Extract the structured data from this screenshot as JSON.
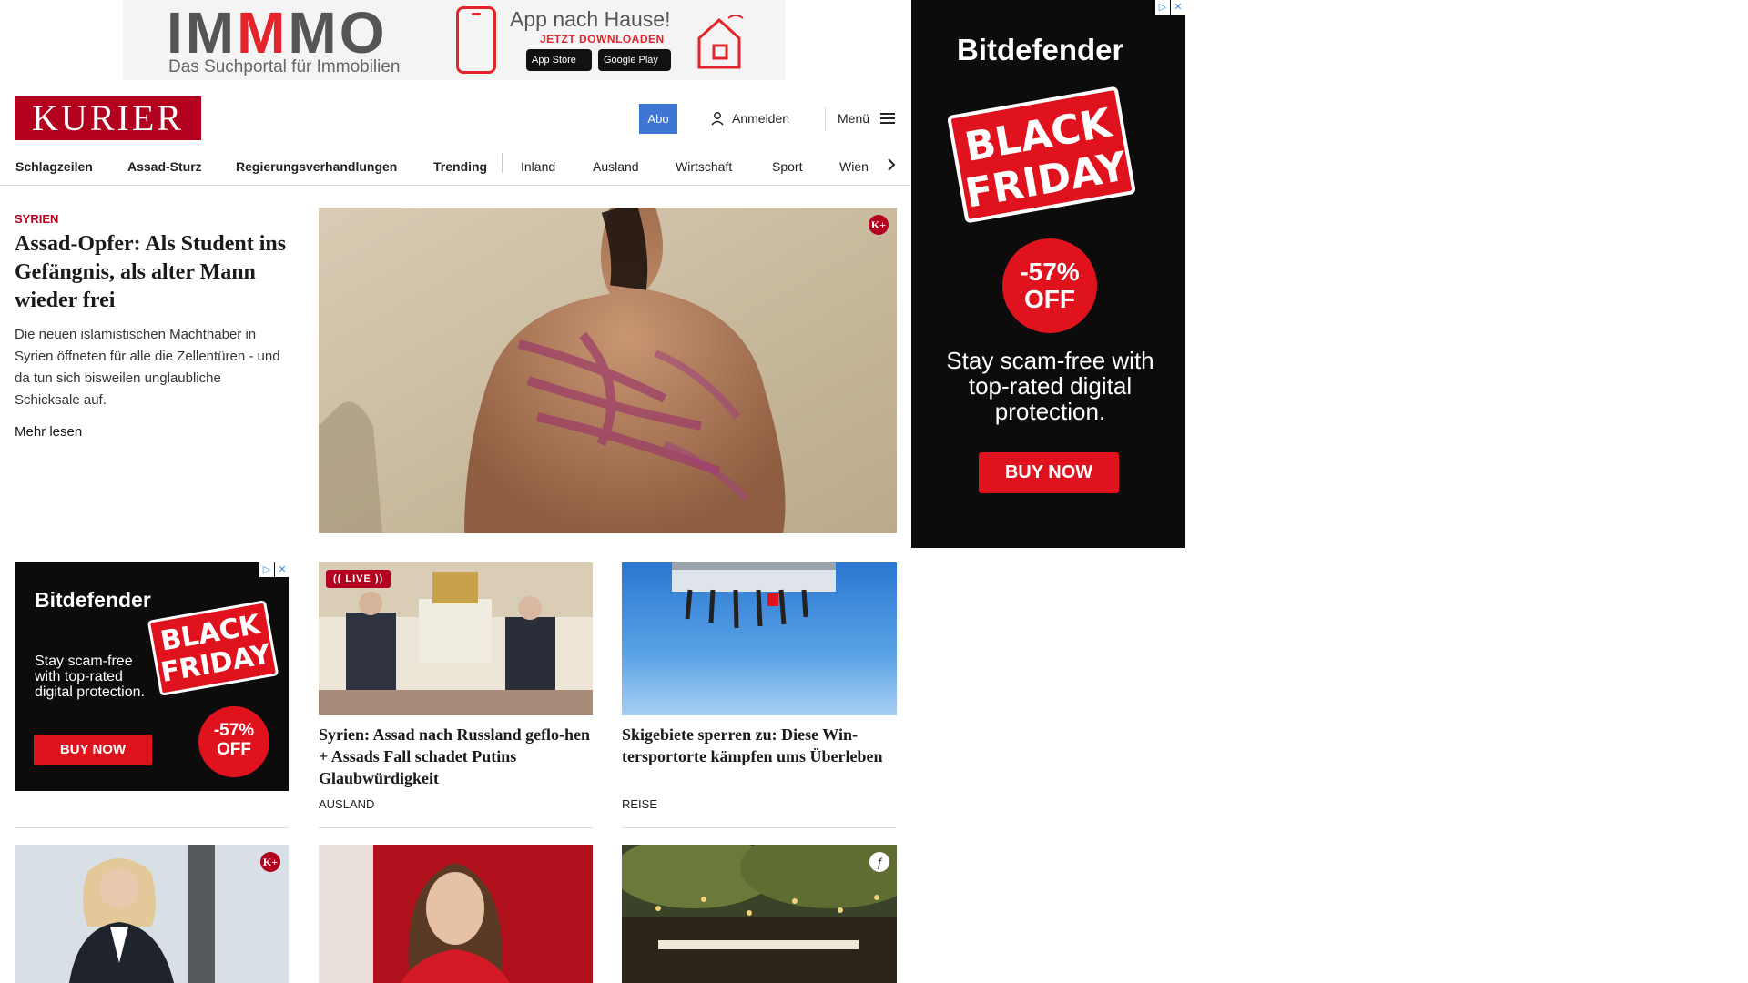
{
  "top_ad": {
    "brand": "IMMMO",
    "brand_prefix": "IM",
    "brand_accent": "M",
    "brand_suffix": "MO",
    "tagline": "Das Suchportal für Immobilien",
    "app_title": "App nach Hause!",
    "app_cta": "JETZT DOWNLOADEN",
    "store_apple": "App Store",
    "store_google": "Google Play",
    "accent_color": "#e3242b"
  },
  "header": {
    "logo": "KURIER",
    "abo_label": "Abo",
    "login_label": "Anmelden",
    "menu_label": "Menü",
    "brand_color": "#b3001e",
    "abo_color": "#3f75d3"
  },
  "nav": {
    "items": [
      {
        "label": "Schlagzeilen",
        "bold": true
      },
      {
        "label": "Assad-Sturz",
        "bold": true
      },
      {
        "label": "Regierungsverhandlungen",
        "bold": true
      },
      {
        "label": "Trending",
        "bold": true
      },
      {
        "label": "Inland",
        "bold": false
      },
      {
        "label": "Ausland",
        "bold": false
      },
      {
        "label": "Wirtschaft",
        "bold": false
      },
      {
        "label": "Sport",
        "bold": false
      },
      {
        "label": "Wien",
        "bold": false
      }
    ]
  },
  "lead": {
    "kicker": "SYRIEN",
    "title": "Assad-Opfer: Als Student ins Gefängnis, als alter Mann wieder frei",
    "teaser": "Die neuen islamistischen Machthaber in Syrien öffneten für alle die Zellentüren - und da tun sich bisweilen unglaubliche Schicksale auf.",
    "more": "Mehr lesen",
    "badge": "K+"
  },
  "sky_ad": {
    "brand": "Bitdefender",
    "promo_line1": "BLACK",
    "promo_line2": "FRIDAY",
    "discount": "-57%",
    "discount_suffix": "OFF",
    "headline": "Stay scam-free with top-rated digital protection.",
    "cta": "BUY NOW",
    "adchoice_play": "▷",
    "adchoice_close": "✕"
  },
  "inline_ad": {
    "brand": "Bitdefender",
    "promo_line1": "BLACK",
    "promo_line2": "FRIDAY",
    "headline": "Stay scam-free with top-rated digital protection.",
    "cta": "BUY NOW",
    "discount": "-57%",
    "discount_suffix": "OFF"
  },
  "cards": [
    {
      "live": "(( LIVE ))",
      "title": "Syrien: Assad nach Russland geflo-hen + Assads Fall schadet Putins Glaubwürdigkeit",
      "category": "AUSLAND"
    },
    {
      "title": "Skigebiete sperren zu: Diese Win-tersportorte kämpfen ums Überleben",
      "category": "REISE"
    }
  ],
  "bottom_cards": [
    {
      "badge": "K+"
    },
    {
      "badge": ""
    },
    {
      "badge": "ƒ"
    }
  ]
}
